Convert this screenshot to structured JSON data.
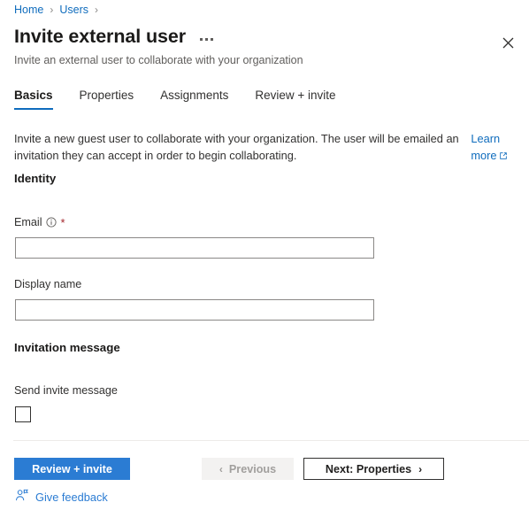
{
  "breadcrumb": {
    "items": [
      {
        "label": "Home"
      },
      {
        "label": "Users"
      }
    ],
    "separator": "›"
  },
  "header": {
    "title": "Invite external user",
    "subtitle": "Invite an external user to collaborate with your organization",
    "more_actions_label": "···",
    "close_label": "Close",
    "close_icon": "close-icon"
  },
  "tabs": [
    {
      "label": "Basics",
      "active": true
    },
    {
      "label": "Properties",
      "active": false
    },
    {
      "label": "Assignments",
      "active": false
    },
    {
      "label": "Review + invite",
      "active": false
    }
  ],
  "intro": {
    "text": "Invite a new guest user to collaborate with your organization. The user will be emailed an invitation they can accept in order to begin collaborating.",
    "learn_more": "Learn more",
    "learn_more_icon": "external-link-icon"
  },
  "sections": {
    "identity": {
      "heading": "Identity",
      "fields": [
        {
          "label": "Email",
          "required_marker": "*",
          "info_icon": "info-circle-icon",
          "value": "",
          "placeholder": ""
        },
        {
          "label": "Display name",
          "value": "",
          "placeholder": ""
        }
      ]
    },
    "invitation": {
      "heading": "Invitation message",
      "checkbox": {
        "label": "Send invite message",
        "checked": false
      }
    }
  },
  "footer": {
    "primary_button": "Review + invite",
    "previous_button": "Previous",
    "previous_chevron": "‹",
    "previous_disabled": true,
    "next_button": "Next: Properties",
    "next_chevron": "›",
    "feedback_label": "Give feedback",
    "feedback_icon": "person-feedback-icon"
  },
  "colors": {
    "accent": "#0f6cbd",
    "primary_button_bg": "#2b7cd3",
    "link": "#0f6cbd",
    "required_asterisk": "#a4262c",
    "disabled_bg": "#f3f2f1",
    "disabled_text": "#a19f9d",
    "border": "#8a8886",
    "divider": "#edebe9",
    "text": "#201f1e",
    "muted_text": "#605e5c"
  }
}
